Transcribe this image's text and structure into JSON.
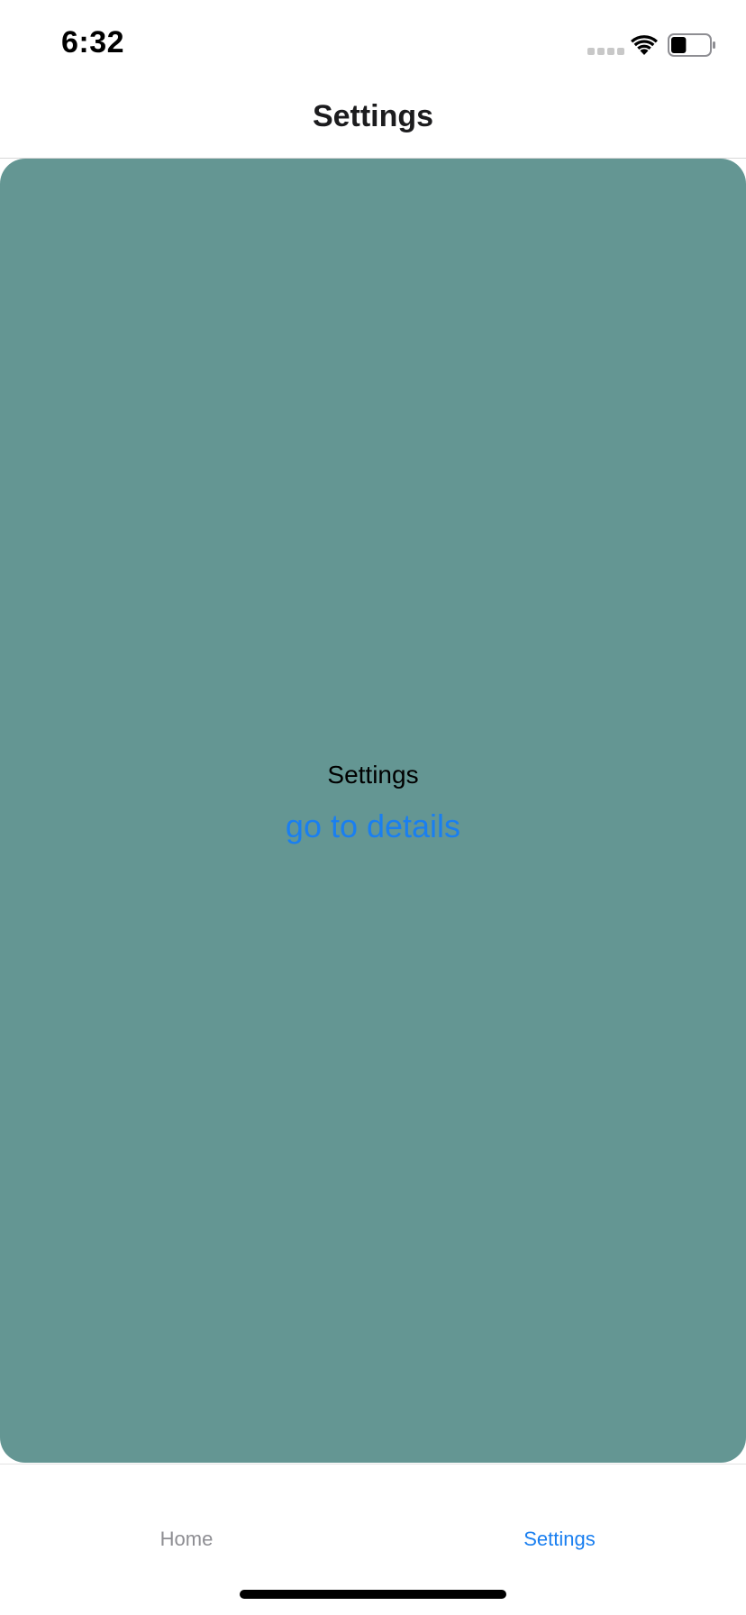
{
  "status_bar": {
    "time": "6:32",
    "signal_icon": "signal-dots-icon",
    "wifi_icon": "wifi-icon",
    "battery_icon": "battery-icon",
    "battery_level": 0.4
  },
  "header": {
    "title": "Settings"
  },
  "content": {
    "label": "Settings",
    "link_text": "go to details",
    "background_color": "#649693"
  },
  "tab_bar": {
    "tabs": [
      {
        "label": "Home",
        "active": false
      },
      {
        "label": "Settings",
        "active": true
      }
    ],
    "active_color": "#1a7ff0",
    "inactive_color": "#8e8e93"
  }
}
